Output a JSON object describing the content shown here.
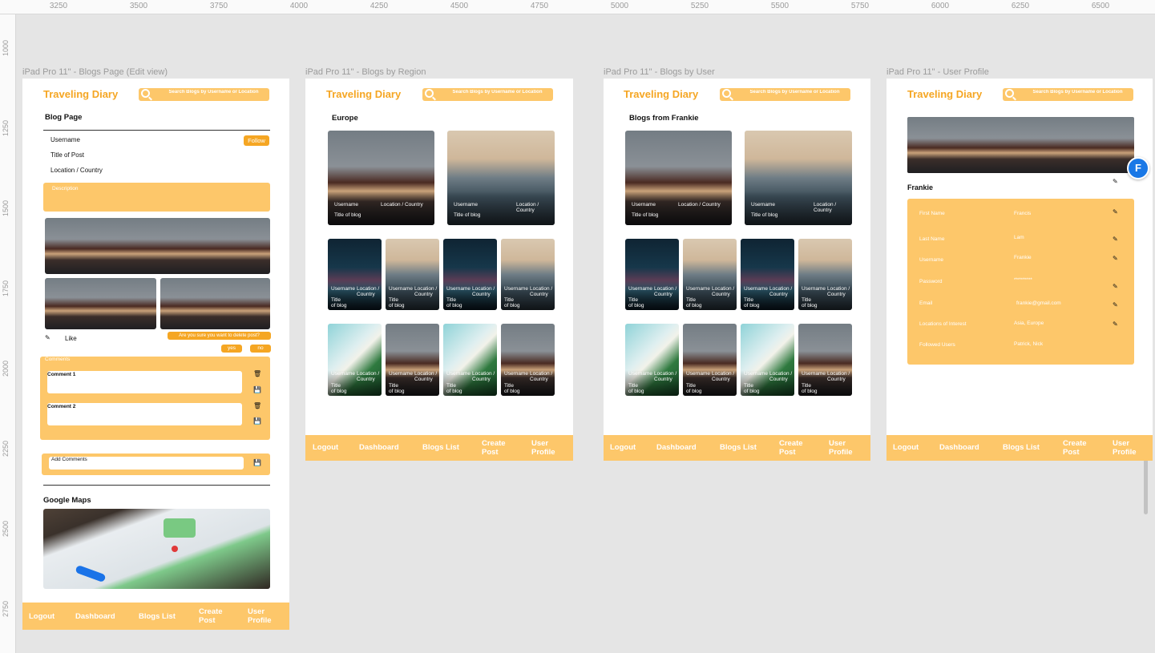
{
  "ruler": {
    "top": [
      "3250",
      "3500",
      "3750",
      "4000",
      "4250",
      "4500",
      "4750",
      "5000",
      "5250",
      "5500",
      "5750",
      "6000",
      "6250",
      "6500"
    ],
    "left": [
      "1000",
      "1250",
      "1500",
      "1750",
      "2000",
      "2250",
      "2500",
      "2750"
    ]
  },
  "common": {
    "logo": "Traveling Diary",
    "search": "Search Blogs by Username or Location",
    "nav": [
      "Logout",
      "Dashboard",
      "Blogs List",
      "Create\nPost",
      "User\nProfile"
    ]
  },
  "frames": {
    "blog_page": "iPad Pro 11\" - Blogs Page (Edit view)",
    "by_region": "iPad Pro 11\" - Blogs by Region",
    "by_user": "iPad Pro 11\" - Blogs by User",
    "user_profile": "iPad Pro 11\" - User Profile"
  },
  "blog": {
    "title": "Blog Page",
    "username": "Username",
    "follow": "Follow",
    "post_title": "Title of Post",
    "location": "Location / Country",
    "description": "Description",
    "like": "Like",
    "delete_confirm": "Are you sure you want to delete post?",
    "yes": "yes",
    "no": "no",
    "comments": "Comments",
    "comment1": "Comment 1",
    "comment2": "Comment 2",
    "add_comments": "Add Comments",
    "maps": "Google Maps"
  },
  "region": {
    "heading": "Europe"
  },
  "user": {
    "heading": "Blogs from Frankie"
  },
  "card": {
    "username": "Username",
    "location_one_line": "Location / Country",
    "location_two_line": "Location /\nCountry",
    "title_one_line": "Title of blog",
    "title_two_line": "Title\nof blog"
  },
  "profile": {
    "name": "Frankie",
    "fields": [
      {
        "label": "First Name",
        "value": "Francis"
      },
      {
        "label": "Last Name",
        "value": "Lam"
      },
      {
        "label": "Username",
        "value": "Frankie"
      },
      {
        "label": "Password",
        "value": "*********"
      },
      {
        "label": "Email",
        "value": "frankie@gmail.com"
      },
      {
        "label": "Locations of Interest",
        "value": "Asia, Europe"
      },
      {
        "label": "Followed Users",
        "value": "Patrick, Nick"
      }
    ]
  },
  "avatar_letter": "F",
  "colors": {
    "accent": "#fdc76a",
    "logo": "#f5a623"
  }
}
